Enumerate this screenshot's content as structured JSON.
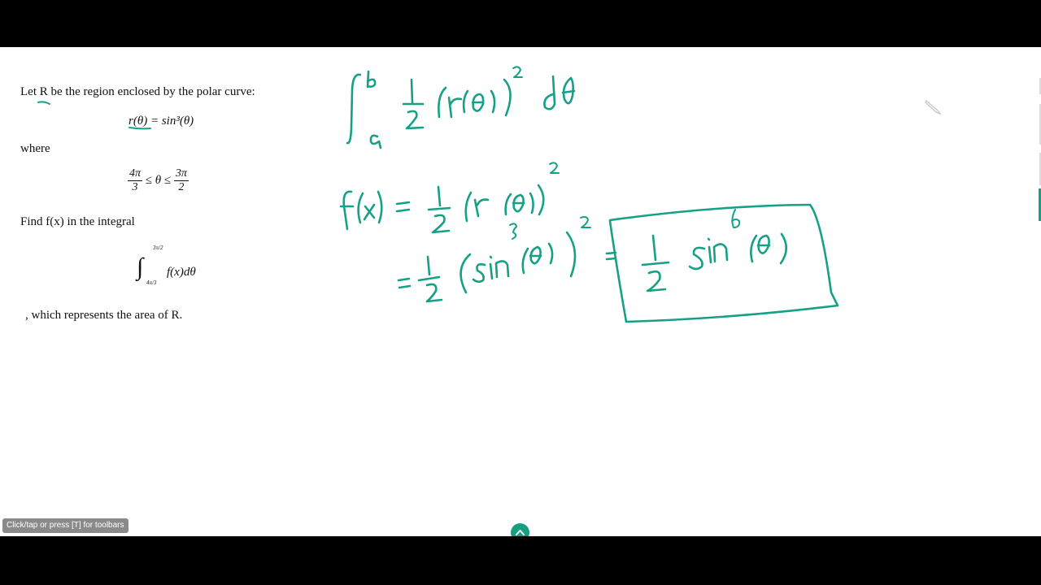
{
  "problem": {
    "line1": "Let R be the region enclosed by the polar curve:",
    "curve": "r(θ) = sin³(θ)",
    "where": "where",
    "bounds_left_num": "4π",
    "bounds_left_den": "3",
    "bounds_mid": "≤ θ ≤",
    "bounds_right_num": "3π",
    "bounds_right_den": "2",
    "find": "Find f(x) in the integral",
    "integral_upper": "3π/2",
    "integral_lower": "4π/3",
    "integrand": "f(x)dθ",
    "tail": ", which represents the area of R."
  },
  "handwriting": {
    "line1": "∫ₐᵇ ½ (r(θ))² dθ",
    "line2": "f(x) = ½ (r(θ))²",
    "line3": "= ½ (sin³(θ))² =",
    "boxed": "½ sin⁶(θ)"
  },
  "ui": {
    "toolbar_hint": "Click/tap or press [T] for toolbars"
  },
  "colors": {
    "ink": "#16a085",
    "canvas": "#ffffff",
    "letterbox": "#000000"
  }
}
